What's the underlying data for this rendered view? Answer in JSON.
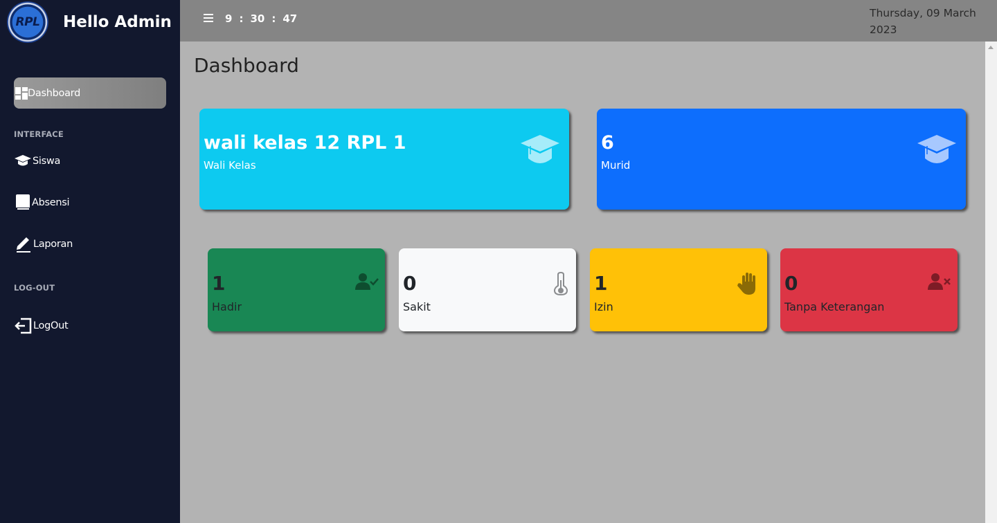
{
  "sidebar": {
    "logo_text": "RPL",
    "brand_title": "Hello Admin",
    "items": [
      {
        "label": "Dashboard",
        "icon": "dashboard-icon",
        "active": true
      },
      {
        "label": "Siswa",
        "icon": "graduation-cap-icon"
      },
      {
        "label": "Absensi",
        "icon": "book-icon"
      },
      {
        "label": "Laporan",
        "icon": "pencil-icon"
      },
      {
        "label": "LogOut",
        "icon": "logout-icon"
      }
    ],
    "sections": {
      "interface": "INTERFACE",
      "logout": "LOG-OUT"
    }
  },
  "topbar": {
    "clock": {
      "hours": "9",
      "minutes": "30",
      "seconds": "47",
      "separator": ":"
    },
    "date": "Thursday, 09 March 2023"
  },
  "main": {
    "title": "Dashboard",
    "summary_cards": [
      {
        "value": "wali kelas 12 RPL 1",
        "label": "Wali Kelas",
        "icon": "graduation-cap-icon",
        "color": "#0dcaf0"
      },
      {
        "value": "6",
        "label": "Murid",
        "icon": "graduation-cap-icon",
        "color": "#0d6efd"
      }
    ],
    "stats": [
      {
        "value": "1",
        "label": "Hadir",
        "icon": "user-check-icon",
        "color": "#198754"
      },
      {
        "value": "0",
        "label": "Sakit",
        "icon": "thermometer-icon",
        "color": "#f8f9fa"
      },
      {
        "value": "1",
        "label": "Izin",
        "icon": "hand-icon",
        "color": "#ffc107"
      },
      {
        "value": "0",
        "label": "Tanpa Keterangan",
        "icon": "user-x-icon",
        "color": "#dc3545"
      }
    ]
  }
}
